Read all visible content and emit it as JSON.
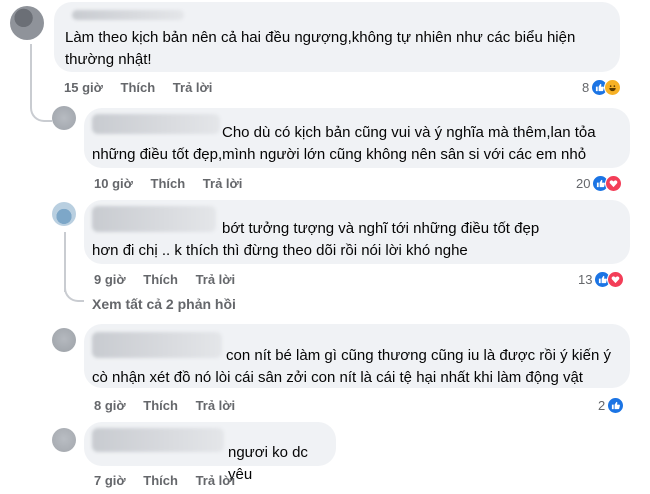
{
  "comments": [
    {
      "text": "Làm theo kịch bản nên cả hai đều ngượng,không tự nhiên như các biểu hiện thường nhật!",
      "time": "15 giờ",
      "like": "Thích",
      "reply": "Trả lời",
      "reactions": {
        "count": "8",
        "types": [
          "like-icon",
          "haha-icon"
        ]
      }
    },
    {
      "text": "Cho dù có kịch bản cũng vui và ý nghĩa mà thêm,lan tỏa những điều tốt đẹp,mình người lớn cũng không nên sân si với các em nhỏ",
      "time": "10 giờ",
      "like": "Thích",
      "reply": "Trả lời",
      "reactions": {
        "count": "20",
        "types": [
          "like-icon",
          "love-icon"
        ]
      }
    },
    {
      "text": "bớt tưởng tượng và nghĩ tới những điều tốt đẹp hơn đi chị .. k thích thì đừng theo dõi rồi nói lời khó nghe",
      "time": "9 giờ",
      "like": "Thích",
      "reply": "Trả lời",
      "reactions": {
        "count": "13",
        "types": [
          "like-icon",
          "love-icon"
        ]
      }
    },
    {
      "text": "con nít bé làm gì cũng thương cũng iu là được rồi ý kiến ý cò nhận xét đồ nó lòi cái sân zởi con nít là cái tệ hại nhất khi làm động vật",
      "time": "8 giờ",
      "like": "Thích",
      "reply": "Trả lời",
      "reactions": {
        "count": "2",
        "types": [
          "like-icon"
        ]
      }
    },
    {
      "text": "ngươi ko dc yêu",
      "time": "7 giờ",
      "like": "Thích",
      "reply": "Trả lời"
    }
  ],
  "view_replies": "Xem tất cả 2 phản hồi",
  "colors": {
    "like": "#1b74e4",
    "love": "#f33e58",
    "haha": "#f7b125",
    "meta": "#65676b",
    "bubble": "#f0f2f5"
  }
}
